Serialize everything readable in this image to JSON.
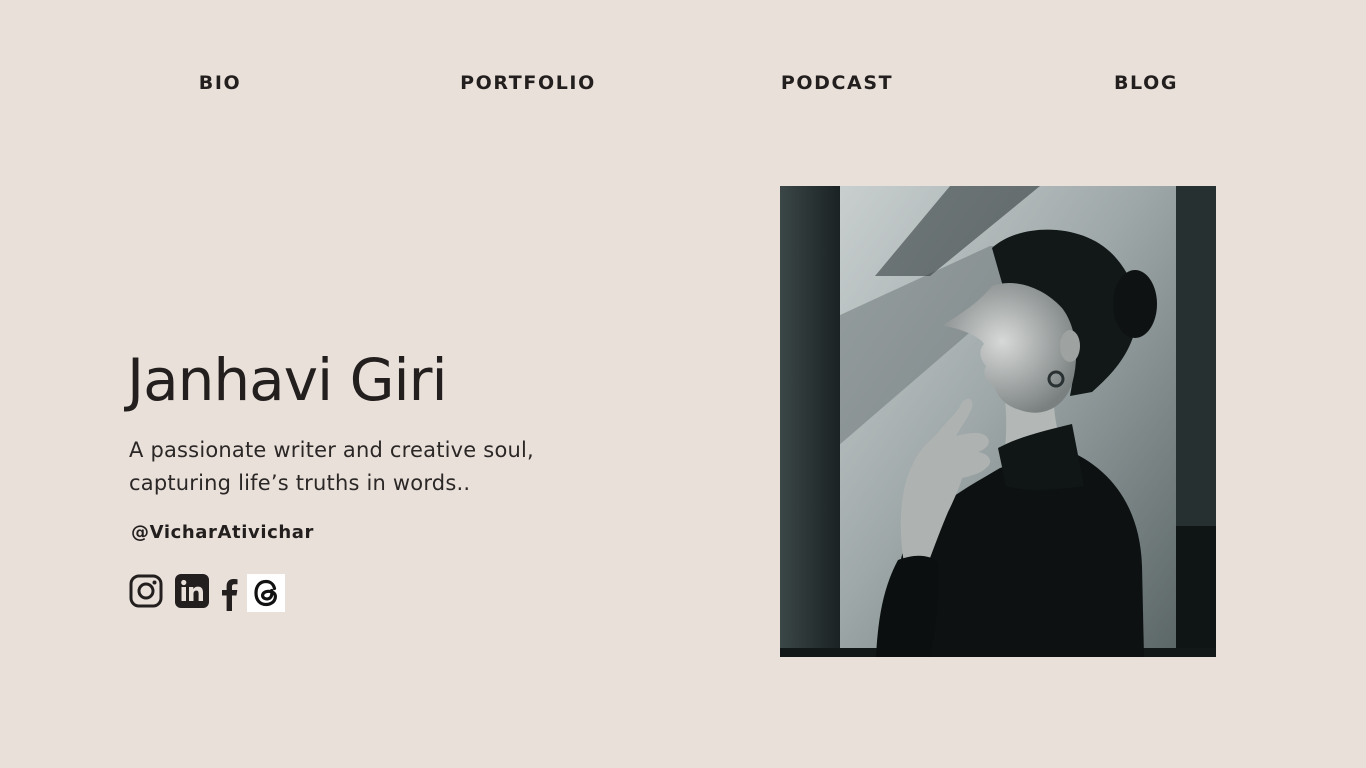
{
  "nav": {
    "items": [
      {
        "label": "BIO"
      },
      {
        "label": "PORTFOLIO"
      },
      {
        "label": "PODCAST"
      },
      {
        "label": "BLOG"
      }
    ]
  },
  "hero": {
    "name": "Janhavi Giri",
    "tagline_line1": "A passionate writer and creative soul,",
    "tagline_line2": "capturing life’s truths in words..",
    "handle": "@VicharAtivichar"
  },
  "socials": [
    {
      "icon": "instagram-icon"
    },
    {
      "icon": "linkedin-icon"
    },
    {
      "icon": "facebook-icon"
    },
    {
      "icon": "threads-icon"
    }
  ],
  "photo": {
    "description_icon": "portrait-photo"
  },
  "colors": {
    "background": "#e9e0da",
    "text": "#231f1e",
    "photo_dark": "#1d2526"
  }
}
